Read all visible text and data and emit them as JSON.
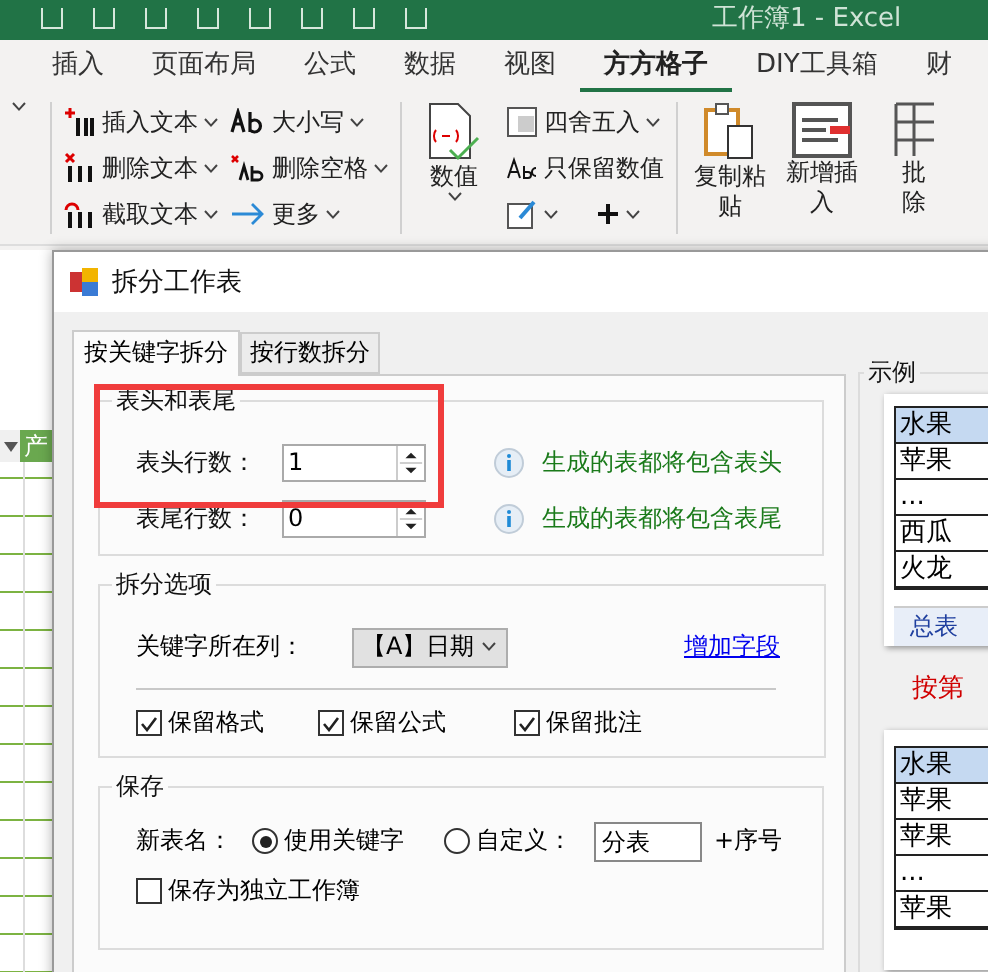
{
  "title_bar": {
    "title": "工作簿1 - Excel"
  },
  "ribbon_tabs": [
    {
      "label": "插入",
      "selected": false
    },
    {
      "label": "页面布局",
      "selected": false
    },
    {
      "label": "公式",
      "selected": false
    },
    {
      "label": "数据",
      "selected": false
    },
    {
      "label": "视图",
      "selected": false
    },
    {
      "label": "方方格子",
      "selected": true
    },
    {
      "label": "DIY工具箱",
      "selected": false
    },
    {
      "label": "财",
      "selected": false
    }
  ],
  "ribbon": {
    "text_tools": [
      "插入文本",
      "删除文本",
      "截取文本"
    ],
    "case_tools": [
      "大小写",
      "删除空格",
      "更多"
    ],
    "number_button": "数值",
    "number_tools": [
      "四舍五入",
      "只保留数值"
    ],
    "big_buttons": [
      {
        "lines": [
          "复制粘",
          "贴"
        ]
      },
      {
        "lines": [
          "新增插",
          "入"
        ]
      },
      {
        "lines": [
          "批",
          "除"
        ]
      }
    ]
  },
  "sheet": {
    "column_header": "产"
  },
  "dialog": {
    "title": "拆分工作表",
    "tabs": [
      {
        "label": "按关键字拆分",
        "selected": true
      },
      {
        "label": "按行数拆分",
        "selected": false
      }
    ],
    "header_footer": {
      "legend": "表头和表尾",
      "highlighted": true,
      "rows": [
        {
          "label": "表头行数：",
          "value": "1",
          "hint": "生成的表都将包含表头"
        },
        {
          "label": "表尾行数：",
          "value": "0",
          "hint": "生成的表都将包含表尾"
        }
      ]
    },
    "split_options": {
      "legend": "拆分选项",
      "key_column_label": "关键字所在列：",
      "key_column_value": "【A】日期",
      "add_field_link": "增加字段",
      "options": [
        {
          "label": "保留格式",
          "checked": true
        },
        {
          "label": "保留公式",
          "checked": true
        },
        {
          "label": "保留批注",
          "checked": true
        }
      ]
    },
    "save": {
      "legend": "保存",
      "new_name_label": "新表名：",
      "modes": [
        {
          "label": "使用关键字",
          "selected": true
        },
        {
          "label": "自定义：",
          "selected": false
        }
      ],
      "custom_value": "分表",
      "suffix": "+序号",
      "own_workbook": {
        "label": "保存为独立工作簿",
        "checked": false
      }
    },
    "example": {
      "legend": "示例",
      "preview_1": {
        "rows": [
          "水果",
          "苹果",
          "...",
          "西瓜",
          "火龙"
        ],
        "sheet_tab": "总表"
      },
      "caption": "按第",
      "preview_2": {
        "rows": [
          "水果",
          "苹果",
          "苹果",
          "...",
          "苹果"
        ]
      }
    }
  }
}
